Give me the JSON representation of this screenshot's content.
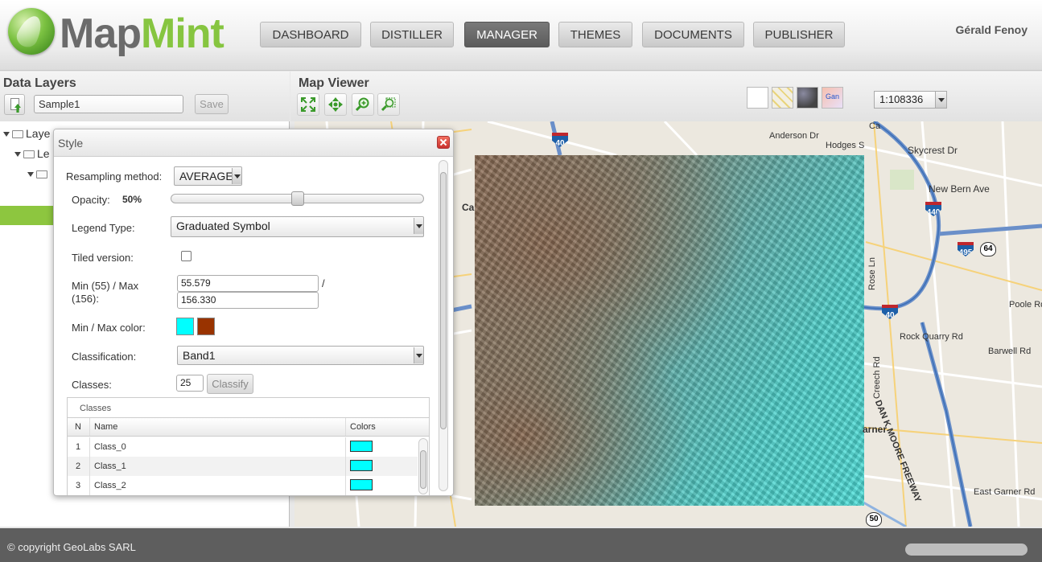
{
  "header": {
    "brand_part1": "Map",
    "brand_part2": "Mint",
    "nav": [
      {
        "label": "DASHBOARD"
      },
      {
        "label": "DISTILLER"
      },
      {
        "label": "MANAGER"
      },
      {
        "label": "THEMES"
      },
      {
        "label": "DOCUMENTS"
      },
      {
        "label": "PUBLISHER"
      }
    ],
    "active_nav": "MANAGER",
    "user": "Gérald Fenoy"
  },
  "left_panel": {
    "title": "Data Layers",
    "name_value": "Sample1",
    "save_label": "Save",
    "tree": [
      {
        "label": "Laye"
      },
      {
        "label": "Le"
      },
      {
        "label": ""
      }
    ]
  },
  "map_viewer": {
    "title": "Map Viewer",
    "scale": "1:108336",
    "basemap_label": "Gan",
    "labels": {
      "skycrest": "Skycrest Dr",
      "new_bern": "New Bern Ave",
      "anderson": "Anderson Dr",
      "hodges": "Hodges S",
      "poole": "Poole Rd",
      "rock_quarry": "Rock Quarry Rd",
      "barwell": "Barwell Rd",
      "dan_moore": "DAN K MOORE FREEWAY",
      "garner": "arner",
      "east_garner": "East Garner Rd",
      "creech": "Creech Rd",
      "rose": "Rose Ln",
      "ca": "Ca",
      "ca2": "Ca"
    },
    "shields": {
      "i40a": "40",
      "i440": "440",
      "i495": "495",
      "us64": "64",
      "i40b": "40",
      "us50": "50"
    }
  },
  "style_dialog": {
    "title": "Style",
    "resampling_label": "Resampling method:",
    "resampling_value": "AVERAGE",
    "opacity_label": "Opacity:",
    "opacity_value": "50%",
    "opacity_fraction": 0.5,
    "legend_type_label": "Legend Type:",
    "legend_type_value": "Graduated Symbol",
    "tiled_label": "Tiled version:",
    "minmax_label_line1": "Min (55) / Max",
    "minmax_label_line2": "(156):",
    "min_value": "55.579",
    "max_value": "156.330",
    "slash": "/",
    "minmax_color_label": "Min / Max color:",
    "min_color": "#00ffff",
    "max_color": "#993300",
    "classification_label": "Classification:",
    "classification_value": "Band1",
    "classes_label": "Classes:",
    "classes_value": "25",
    "classify_label": "Classify",
    "classes_caption": "Classes",
    "columns": {
      "n": "N",
      "name": "Name",
      "colors": "Colors"
    },
    "rows": [
      {
        "n": "1",
        "name": "Class_0",
        "color": "#00ffff"
      },
      {
        "n": "2",
        "name": "Class_1",
        "color": "#00ffff"
      },
      {
        "n": "3",
        "name": "Class_2",
        "color": "#00ffff"
      }
    ]
  },
  "footer": {
    "copyright": "© copyright GeoLabs SARL"
  }
}
